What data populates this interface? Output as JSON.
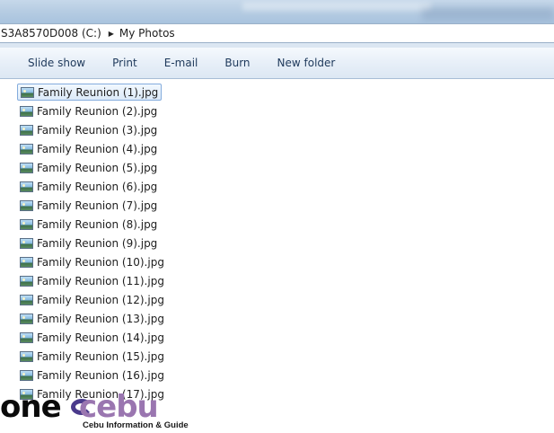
{
  "breadcrumb": {
    "drive": "S3A8570D008 (C:)",
    "separator": "▶",
    "folder": "My Photos"
  },
  "toolbar": {
    "slideshow": "Slide show",
    "print": "Print",
    "email": "E-mail",
    "burn": "Burn",
    "new_folder": "New folder"
  },
  "files": [
    "Family Reunion (1).jpg",
    "Family Reunion (2).jpg",
    "Family Reunion (3).jpg",
    "Family Reunion (4).jpg",
    "Family Reunion (5).jpg",
    "Family Reunion (6).jpg",
    "Family Reunion (7).jpg",
    "Family Reunion (8).jpg",
    "Family Reunion (9).jpg",
    "Family Reunion (10).jpg",
    "Family Reunion (11).jpg",
    "Family Reunion (12).jpg",
    "Family Reunion (13).jpg",
    "Family Reunion (14).jpg",
    "Family Reunion (15).jpg",
    "Family Reunion (16).jpg",
    "Family Reunion (17).jpg"
  ],
  "selected_file": "Family Reunion (1).jpg",
  "file_icon": "jpeg-image-icon",
  "watermark": {
    "word1": "one",
    "word2": "cebu",
    "tagline": "Cebu Information & Guide"
  },
  "colors": {
    "selection_border": "#84acdd",
    "toolbar_text": "#1e395b",
    "logo_purple": "#9a76b0"
  }
}
